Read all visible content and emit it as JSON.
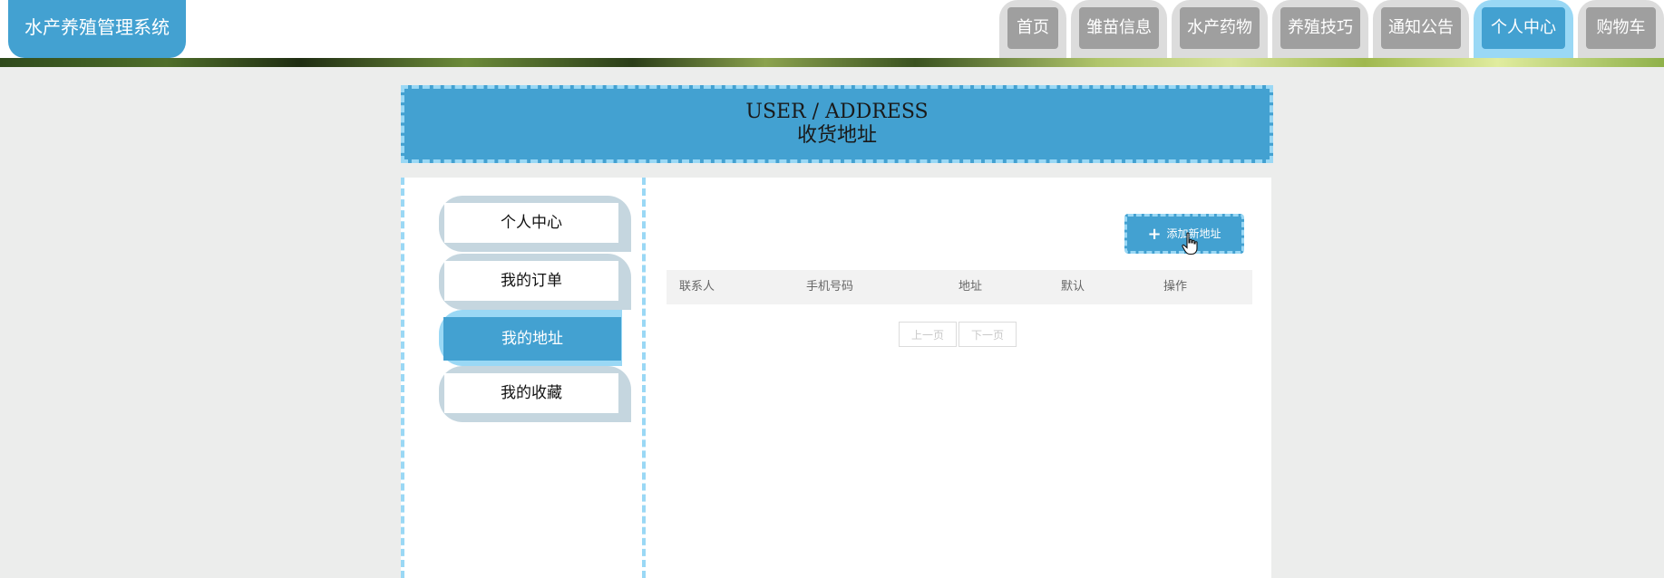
{
  "header": {
    "logo_text": "水产养殖管理系统",
    "nav": [
      {
        "label": "首页",
        "active": false
      },
      {
        "label": "雏苗信息",
        "active": false
      },
      {
        "label": "水产药物",
        "active": false
      },
      {
        "label": "养殖技巧",
        "active": false
      },
      {
        "label": "通知公告",
        "active": false
      },
      {
        "label": "个人中心",
        "active": true
      },
      {
        "label": "购物车",
        "active": false
      }
    ]
  },
  "title": {
    "en": "USER / ADDRESS",
    "cn": "收货地址"
  },
  "sidebar": {
    "items": [
      {
        "label": "个人中心",
        "active": false
      },
      {
        "label": "我的订单",
        "active": false
      },
      {
        "label": "我的地址",
        "active": true
      },
      {
        "label": "我的收藏",
        "active": false
      }
    ]
  },
  "main": {
    "add_button_label": "添加新地址",
    "add_button_icon": "plus-icon",
    "table": {
      "columns": [
        "联系人",
        "手机号码",
        "地址",
        "默认",
        "操作"
      ],
      "rows": []
    },
    "pager": {
      "prev_label": "上一页",
      "next_label": "下一页"
    }
  },
  "colors": {
    "accent": "#43a1d1",
    "accent_light": "#9ad8f5",
    "nav_inactive": "#9f9f9f",
    "page_bg": "#ecedec"
  }
}
